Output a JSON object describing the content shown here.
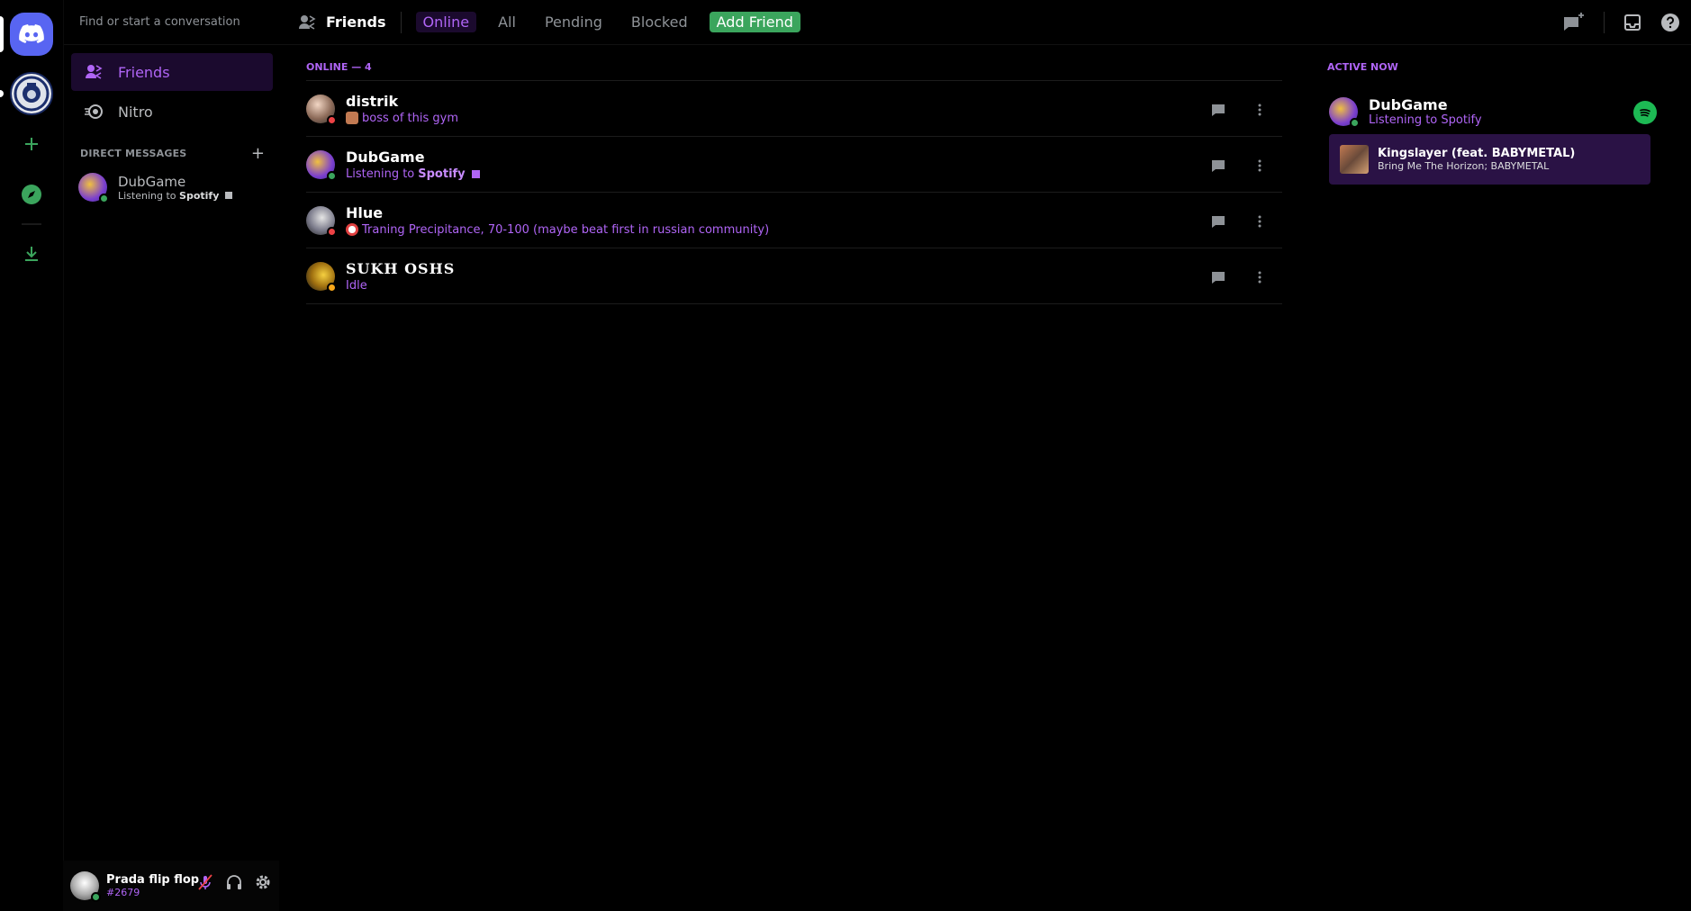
{
  "search": {
    "placeholder": "Find or start a conversation"
  },
  "sidebar": {
    "friends_label": "Friends",
    "nitro_label": "Nitro",
    "direct_messages_title": "DIRECT MESSAGES",
    "dms": [
      {
        "name": "DubGame",
        "activity_prefix": "Listening to",
        "activity_app": "Spotify"
      }
    ]
  },
  "user": {
    "name": "Prada flip flop",
    "tag": "#2679"
  },
  "topbar": {
    "title": "Friends",
    "tabs": [
      "Online",
      "All",
      "Pending",
      "Blocked"
    ],
    "add_friend": "Add Friend"
  },
  "friends": {
    "header": "ONLINE — 4",
    "rows": [
      {
        "name": "distrik",
        "status": "boss of this gym",
        "presence": "dnd"
      },
      {
        "name": "DubGame",
        "status_prefix": "Listening to",
        "status_app": "Spotify",
        "presence": "online"
      },
      {
        "name": "Hlue",
        "status": "Traning Precipitance, 70-100 (maybe beat first in russian community)",
        "presence": "dnd"
      },
      {
        "name": "SUKH OSHS",
        "status": "Idle",
        "presence": "idle"
      }
    ]
  },
  "active_now": {
    "title": "ACTIVE NOW",
    "user": "DubGame",
    "activity": "Listening to Spotify",
    "track": "Kingslayer (feat. BABYMETAL)",
    "artist": "Bring Me The Horizon; BABYMETAL"
  },
  "colors": {
    "accent": "#b065f6",
    "online": "#3ba55d",
    "dnd": "#ed4245",
    "idle": "#faa81a",
    "brand": "#5865f2",
    "spotify": "#1db954"
  }
}
